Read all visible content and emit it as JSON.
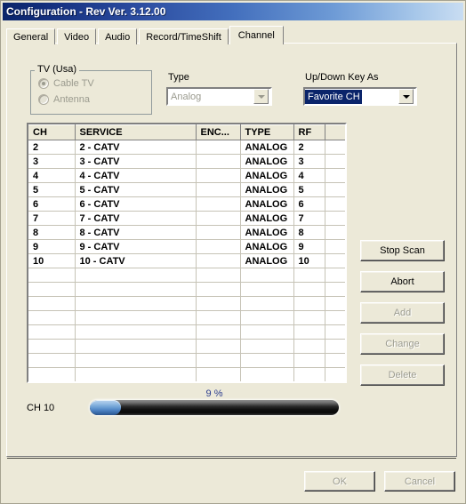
{
  "window": {
    "title": "Configuration - Rev Ver. 3.12.00",
    "accent_titlebar_dark": "#0a246a",
    "accent_titlebar_light": "#c9ddf2",
    "dialog_background": "#ECE9D8"
  },
  "tabs": [
    {
      "label": "General",
      "active": false
    },
    {
      "label": "Video",
      "active": false
    },
    {
      "label": "Audio",
      "active": false
    },
    {
      "label": "Record/TimeShift",
      "active": false
    },
    {
      "label": "Channel",
      "active": true
    }
  ],
  "tv_group": {
    "legend": "TV (Usa)",
    "options": [
      {
        "label": "Cable TV",
        "checked": true,
        "disabled": true
      },
      {
        "label": "Antenna",
        "checked": false,
        "disabled": true
      }
    ]
  },
  "type_field": {
    "label": "Type",
    "value": "Analog",
    "disabled": true
  },
  "updown_field": {
    "label": "Up/Down Key As",
    "value": "Favorite CH",
    "selected": true,
    "highlight_color": "#0a246a"
  },
  "table": {
    "columns": [
      "CH",
      "SERVICE",
      "ENC...",
      "TYPE",
      "RF",
      ""
    ],
    "rows": [
      {
        "ch": "2",
        "service": "2 - CATV",
        "enc": "",
        "type": "ANALOG",
        "rf": "2",
        "end": ""
      },
      {
        "ch": "3",
        "service": "3 - CATV",
        "enc": "",
        "type": "ANALOG",
        "rf": "3",
        "end": ""
      },
      {
        "ch": "4",
        "service": "4 - CATV",
        "enc": "",
        "type": "ANALOG",
        "rf": "4",
        "end": ""
      },
      {
        "ch": "5",
        "service": "5 - CATV",
        "enc": "",
        "type": "ANALOG",
        "rf": "5",
        "end": ""
      },
      {
        "ch": "6",
        "service": "6 - CATV",
        "enc": "",
        "type": "ANALOG",
        "rf": "6",
        "end": ""
      },
      {
        "ch": "7",
        "service": "7 - CATV",
        "enc": "",
        "type": "ANALOG",
        "rf": "7",
        "end": ""
      },
      {
        "ch": "8",
        "service": "8 - CATV",
        "enc": "",
        "type": "ANALOG",
        "rf": "8",
        "end": ""
      },
      {
        "ch": "9",
        "service": "9 - CATV",
        "enc": "",
        "type": "ANALOG",
        "rf": "9",
        "end": ""
      },
      {
        "ch": "10",
        "service": "10 - CATV",
        "enc": "",
        "type": "ANALOG",
        "rf": "10",
        "end": ""
      },
      {
        "ch": "",
        "service": "",
        "enc": "",
        "type": "",
        "rf": "",
        "end": ""
      },
      {
        "ch": "",
        "service": "",
        "enc": "",
        "type": "",
        "rf": "",
        "end": ""
      },
      {
        "ch": "",
        "service": "",
        "enc": "",
        "type": "",
        "rf": "",
        "end": ""
      },
      {
        "ch": "",
        "service": "",
        "enc": "",
        "type": "",
        "rf": "",
        "end": ""
      },
      {
        "ch": "",
        "service": "",
        "enc": "",
        "type": "",
        "rf": "",
        "end": ""
      },
      {
        "ch": "",
        "service": "",
        "enc": "",
        "type": "",
        "rf": "",
        "end": ""
      },
      {
        "ch": "",
        "service": "",
        "enc": "",
        "type": "",
        "rf": "",
        "end": ""
      },
      {
        "ch": "",
        "service": "",
        "enc": "",
        "type": "",
        "rf": "",
        "end": ""
      }
    ]
  },
  "side_buttons": [
    {
      "label": "Stop Scan",
      "disabled": false
    },
    {
      "label": "Abort",
      "disabled": false
    },
    {
      "label": "Add",
      "disabled": true
    },
    {
      "label": "Change",
      "disabled": true
    },
    {
      "label": "Delete",
      "disabled": true
    }
  ],
  "progress": {
    "channel_label": "CH 10",
    "percent_label": "9 %",
    "percent_value": 9,
    "fill_color": "#6c9fd4",
    "text_color": "#2b3d8f"
  },
  "bottom_buttons": [
    {
      "label": "OK",
      "disabled": true
    },
    {
      "label": "Cancel",
      "disabled": true
    }
  ]
}
